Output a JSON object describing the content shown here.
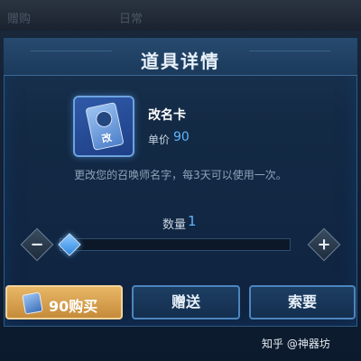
{
  "top_tabs": [
    "赠购",
    "日常"
  ],
  "dialog": {
    "title": "道具详情",
    "item": {
      "name": "改名卡",
      "icon_char": "改",
      "price_label": "单价",
      "price_value": "90",
      "description": "更改您的召唤师名字，每3天可以使用一次。"
    },
    "quantity": {
      "label": "数量",
      "value": "1",
      "minus": "−",
      "plus": "+",
      "slider_fraction": 0.0
    },
    "buttons": {
      "buy": "90购买",
      "gift": "赠送",
      "ask": "索要"
    }
  },
  "watermark": "知乎 @神器坊",
  "colors": {
    "accent_blue": "#5fb5ff",
    "buy_gold": "#e8b766",
    "dialog_bg": "#132a45"
  },
  "icons": [
    "item-card-icon",
    "minus-icon",
    "plus-icon",
    "coin-card-icon"
  ]
}
